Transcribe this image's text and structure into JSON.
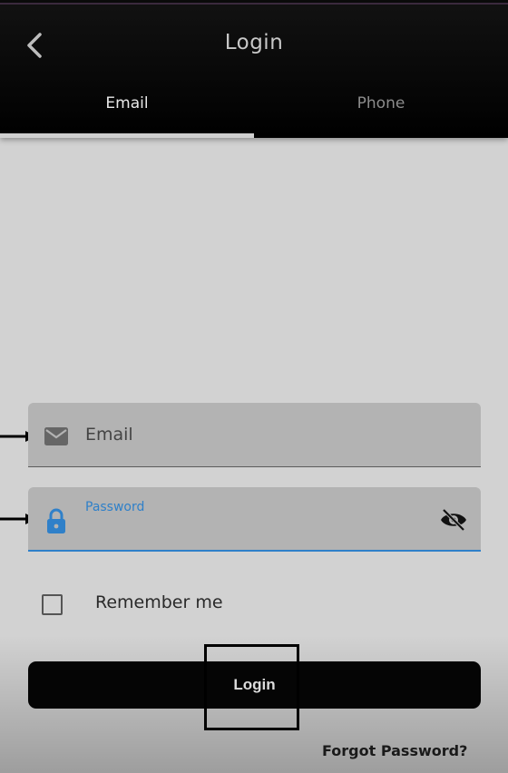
{
  "header": {
    "title": "Login",
    "back_icon": "chevron-left-icon"
  },
  "tabs": [
    {
      "label": "Email",
      "active": true
    },
    {
      "label": "Phone",
      "active": false
    }
  ],
  "form": {
    "email": {
      "placeholder": "Email",
      "icon": "mail-icon"
    },
    "password": {
      "label": "Password",
      "icon": "lock-icon",
      "toggle_icon": "eye-off-icon"
    },
    "remember_me": {
      "label": "Remember me",
      "checked": false
    },
    "login_label": "Login",
    "forgot_label": "Forgot Password?"
  },
  "colors": {
    "accent": "#2f80c9",
    "appbar": "#000000",
    "background": "#d2d2d2",
    "button": "#050505"
  }
}
